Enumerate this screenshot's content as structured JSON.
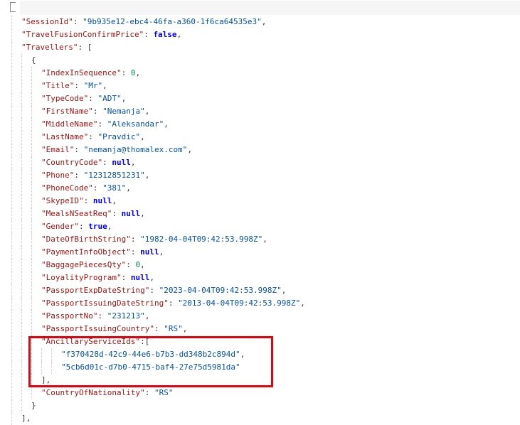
{
  "editor": {
    "lines": [
      {
        "key": "\"SessionId\"",
        "value": "\"9b935e12-ebc4-46fa-a360-1f6ca64535e3\"",
        "type": "string",
        "suffix": ",",
        "indent": 1
      },
      {
        "key": "\"TravelFusionConfirmPrice\"",
        "value": "false",
        "type": "keyword",
        "suffix": ",",
        "indent": 1
      },
      {
        "key": "\"Travellers\"",
        "value": "[",
        "type": "punct",
        "suffix": "",
        "indent": 1
      },
      {
        "key": "",
        "value": "{",
        "type": "punct",
        "suffix": "",
        "indent": 2
      },
      {
        "key": "\"IndexInSequence\"",
        "value": "0",
        "type": "number",
        "suffix": ",",
        "indent": 3
      },
      {
        "key": "\"Title\"",
        "value": "\"Mr\"",
        "type": "string",
        "suffix": ",",
        "indent": 3
      },
      {
        "key": "\"TypeCode\"",
        "value": "\"ADT\"",
        "type": "string",
        "suffix": ",",
        "indent": 3
      },
      {
        "key": "\"FirstName\"",
        "value": "\"Nemanja\"",
        "type": "string",
        "suffix": ",",
        "indent": 3
      },
      {
        "key": "\"MiddleName\"",
        "value": "\"Aleksandar\"",
        "type": "string",
        "suffix": ",",
        "indent": 3
      },
      {
        "key": "\"LastName\"",
        "value": "\"Pravdic\"",
        "type": "string",
        "suffix": ",",
        "indent": 3
      },
      {
        "key": "\"Email\"",
        "value": "\"nemanja@thomalex.com\"",
        "type": "string",
        "suffix": ",",
        "indent": 3
      },
      {
        "key": "\"CountryCode\"",
        "value": "null",
        "type": "keyword",
        "suffix": ",",
        "indent": 3
      },
      {
        "key": "\"Phone\"",
        "value": "\"12312851231\"",
        "type": "string",
        "suffix": ",",
        "indent": 3
      },
      {
        "key": "\"PhoneCode\"",
        "value": "\"381\"",
        "type": "string",
        "suffix": ",",
        "indent": 3
      },
      {
        "key": "\"SkypeID\"",
        "value": "null",
        "type": "keyword",
        "suffix": ",",
        "indent": 3
      },
      {
        "key": "\"MealsNSeatReq\"",
        "value": "null",
        "type": "keyword",
        "suffix": ",",
        "indent": 3
      },
      {
        "key": "\"Gender\"",
        "value": "true",
        "type": "keyword",
        "suffix": ",",
        "indent": 3
      },
      {
        "key": "\"DateOfBirthString\"",
        "value": "\"1982-04-04T09:42:53.998Z\"",
        "type": "string",
        "suffix": ",",
        "indent": 3
      },
      {
        "key": "\"PaymentInfoObject\"",
        "value": "null",
        "type": "keyword",
        "suffix": ",",
        "indent": 3
      },
      {
        "key": "\"BaggagePiecesQty\"",
        "value": "0",
        "type": "number",
        "suffix": ",",
        "indent": 3
      },
      {
        "key": "\"LoyalityProgram\"",
        "value": "null",
        "type": "keyword",
        "suffix": ",",
        "indent": 3
      },
      {
        "key": "\"PassportExpDateString\"",
        "value": "\"2023-04-04T09:42:53.998Z\"",
        "type": "string",
        "suffix": ",",
        "indent": 3
      },
      {
        "key": "\"PassportIssuingDateString\"",
        "value": "\"2013-04-04T09:42:53.998Z\"",
        "type": "string",
        "suffix": ",",
        "indent": 3
      },
      {
        "key": "\"PassportNo\"",
        "value": "\"231213\"",
        "type": "string",
        "suffix": ",",
        "indent": 3
      },
      {
        "key": "\"PassportIssuingCountry\"",
        "value": "\"RS\"",
        "type": "string",
        "suffix": ",",
        "indent": 3
      },
      {
        "key": "\"AncillaryServiceIds\"",
        "value": "[",
        "type": "punct",
        "suffix": "",
        "indent": 3,
        "nospace": true
      },
      {
        "key": "",
        "value": "\"f370428d-42c9-44e6-b7b3-dd348b2c894d\"",
        "type": "string",
        "suffix": ",",
        "indent": 5
      },
      {
        "key": "",
        "value": "\"5cb6d01c-d7b0-4715-baf4-27e75d5981da\"",
        "type": "string",
        "suffix": "",
        "indent": 5
      },
      {
        "key": "",
        "value": "],",
        "type": "punct",
        "suffix": "",
        "indent": 3
      },
      {
        "key": "\"CountryOfNationality\"",
        "value": "\"RS\"",
        "type": "string",
        "suffix": "",
        "indent": 3
      },
      {
        "key": "",
        "value": "}",
        "type": "punct",
        "suffix": "",
        "indent": 2
      },
      {
        "key": "",
        "value": "],",
        "type": "punct",
        "suffix": "",
        "indent": 1
      }
    ]
  },
  "highlight": {
    "color": "#e8000b",
    "label": "AncillaryServiceIds block"
  },
  "colors": {
    "key": "#a31515",
    "string": "#0451a5",
    "number": "#098658",
    "keyword": "#0000ff",
    "guide": "#c8c8c8"
  }
}
